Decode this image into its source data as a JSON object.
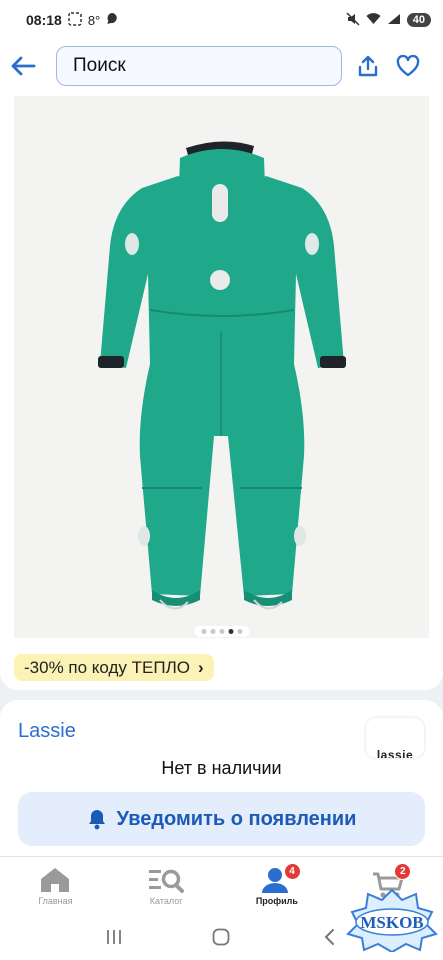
{
  "status": {
    "time": "08:18",
    "temperature": "8°",
    "battery": "40"
  },
  "search": {
    "placeholder": "Поиск"
  },
  "product": {
    "image_count": 5,
    "active_image": 4,
    "promo_text": "-30% по коду ТЕПЛО",
    "promo_chevron": "›"
  },
  "seller": {
    "brand": "Lassie",
    "logo_text": "lassie",
    "stock_status": "Нет в наличии",
    "notify_label": "Уведомить о появлении"
  },
  "nav": {
    "items": [
      {
        "label": "Главная",
        "icon": "home-icon",
        "active": false
      },
      {
        "label": "Каталог",
        "icon": "catalog-icon",
        "active": false
      },
      {
        "label": "Профиль",
        "icon": "profile-icon",
        "active": true,
        "badge": "4"
      },
      {
        "label": "",
        "icon": "cart-icon",
        "active": false,
        "badge": "2"
      }
    ]
  },
  "watermark": {
    "text": "MSKOB"
  },
  "colors": {
    "accent": "#2a6fd0",
    "suit": "#1fa98a",
    "promo_bg": "#fbf3b6",
    "badge": "#e53935"
  }
}
